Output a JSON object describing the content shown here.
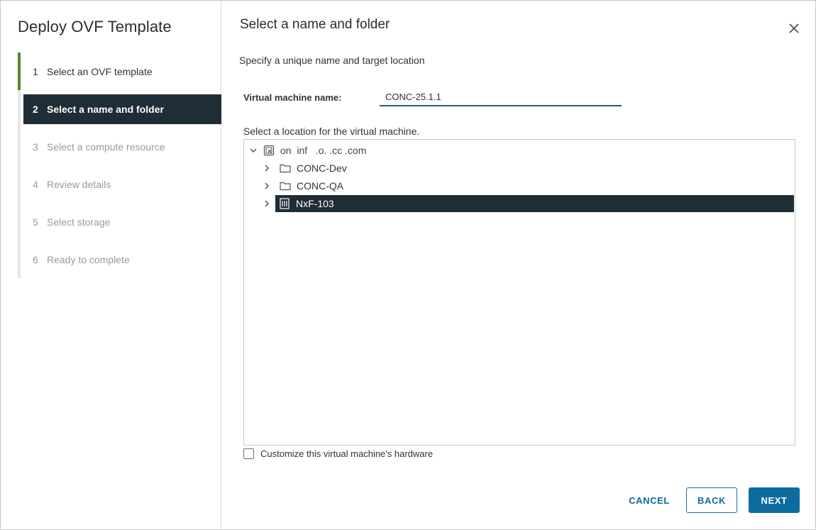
{
  "wizard": {
    "title": "Deploy OVF Template",
    "steps": [
      {
        "num": "1",
        "label": "Select an OVF template",
        "state": "done"
      },
      {
        "num": "2",
        "label": "Select a name and folder",
        "state": "active"
      },
      {
        "num": "3",
        "label": "Select a compute resource",
        "state": "disabled"
      },
      {
        "num": "4",
        "label": "Review details",
        "state": "disabled"
      },
      {
        "num": "5",
        "label": "Select storage",
        "state": "disabled"
      },
      {
        "num": "6",
        "label": "Ready to complete",
        "state": "disabled"
      }
    ]
  },
  "page": {
    "title": "Select a name and folder",
    "subtitle": "Specify a unique name and target location",
    "vm_name_label": "Virtual machine name:",
    "vm_name_value": "CONC-25.1.1",
    "location_label": "Select a location for the virtual machine.",
    "customize_label": "Customize this virtual machine's hardware",
    "customize_checked": false
  },
  "tree": {
    "root": {
      "label": "on  inf   .o. .cc .com",
      "icon": "vcenter-icon",
      "expanded": true
    },
    "children": [
      {
        "label": "CONC-Dev",
        "icon": "folder-icon",
        "selected": false
      },
      {
        "label": "CONC-QA",
        "icon": "folder-icon",
        "selected": false
      },
      {
        "label": "NxF-103",
        "icon": "datacenter-icon",
        "selected": true
      }
    ]
  },
  "buttons": {
    "cancel": "CANCEL",
    "back": "BACK",
    "next": "NEXT"
  },
  "colors": {
    "active_step_bg": "#1f2d37",
    "done_rail": "#5a8a2b",
    "primary": "#0e6b9f"
  }
}
